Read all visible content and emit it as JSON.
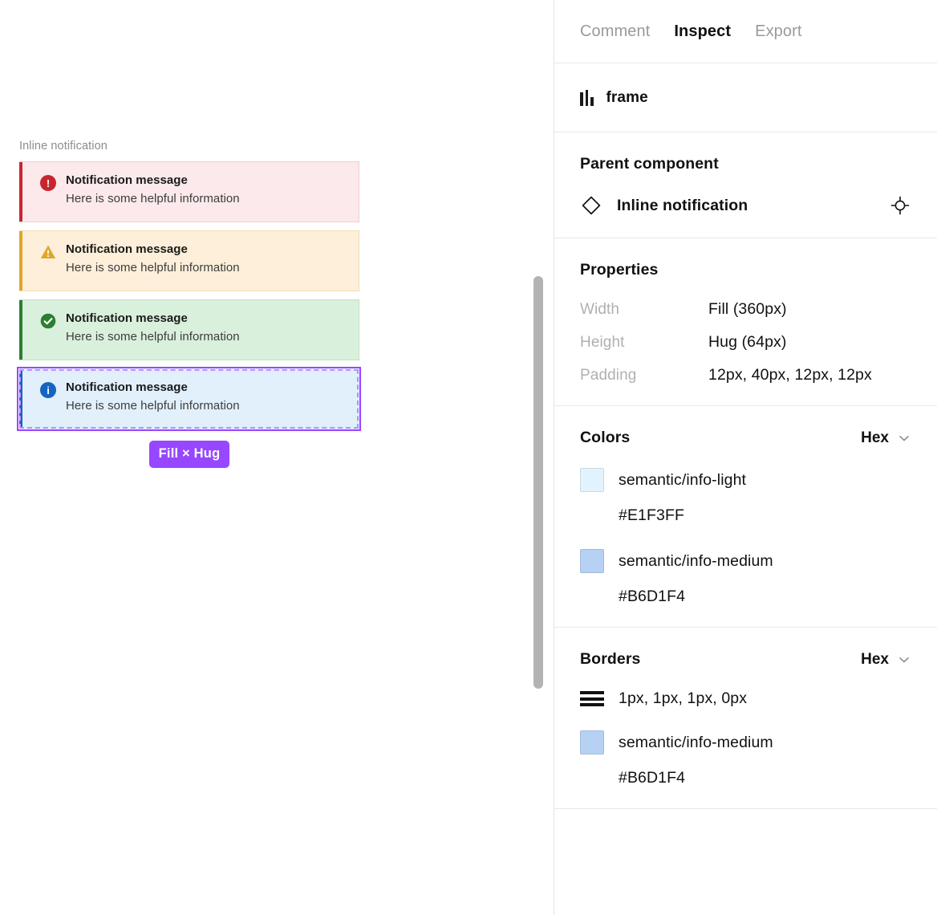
{
  "canvas": {
    "frame_label": "Inline notification",
    "notifications": [
      {
        "variant": "error",
        "icon": "error-circle-icon",
        "title": "Notification message",
        "description": "Here is some helpful information"
      },
      {
        "variant": "warning",
        "icon": "warning-triangle-icon",
        "title": "Notification message",
        "description": "Here is some helpful information"
      },
      {
        "variant": "success",
        "icon": "success-check-icon",
        "title": "Notification message",
        "description": "Here is some helpful information"
      },
      {
        "variant": "info",
        "icon": "info-circle-icon",
        "title": "Notification message",
        "description": "Here is some helpful information"
      }
    ],
    "selection_badge": "Fill × Hug",
    "selection_color": "#9747FF"
  },
  "panel": {
    "tabs": [
      {
        "label": "Comment",
        "active": false
      },
      {
        "label": "Inspect",
        "active": true
      },
      {
        "label": "Export",
        "active": false
      }
    ],
    "node": {
      "icon": "frame-icon",
      "name": "frame"
    },
    "parent_component": {
      "section_title": "Parent component",
      "icon": "component-diamond-icon",
      "name": "Inline notification",
      "action_icon": "target-locate-icon"
    },
    "properties": {
      "section_title": "Properties",
      "rows": [
        {
          "key": "Width",
          "value": "Fill (360px)"
        },
        {
          "key": "Height",
          "value": "Hug (64px)"
        },
        {
          "key": "Padding",
          "value": "12px, 40px, 12px, 12px"
        }
      ]
    },
    "colors": {
      "section_title": "Colors",
      "units_label": "Hex",
      "units_icon": "chevron-down-icon",
      "tokens": [
        {
          "name": "semantic/info-light",
          "hex": "#E1F3FF",
          "swatch": "#E1F3FF"
        },
        {
          "name": "semantic/info-medium",
          "hex": "#B6D1F4",
          "swatch": "#B6D1F4"
        }
      ]
    },
    "borders": {
      "section_title": "Borders",
      "units_label": "Hex",
      "units_icon": "chevron-down-icon",
      "widths_icon": "border-width-stack-icon",
      "widths": "1px, 1px, 1px, 0px",
      "tokens": [
        {
          "name": "semantic/info-medium",
          "hex": "#B6D1F4",
          "swatch": "#B6D1F4"
        }
      ]
    }
  }
}
